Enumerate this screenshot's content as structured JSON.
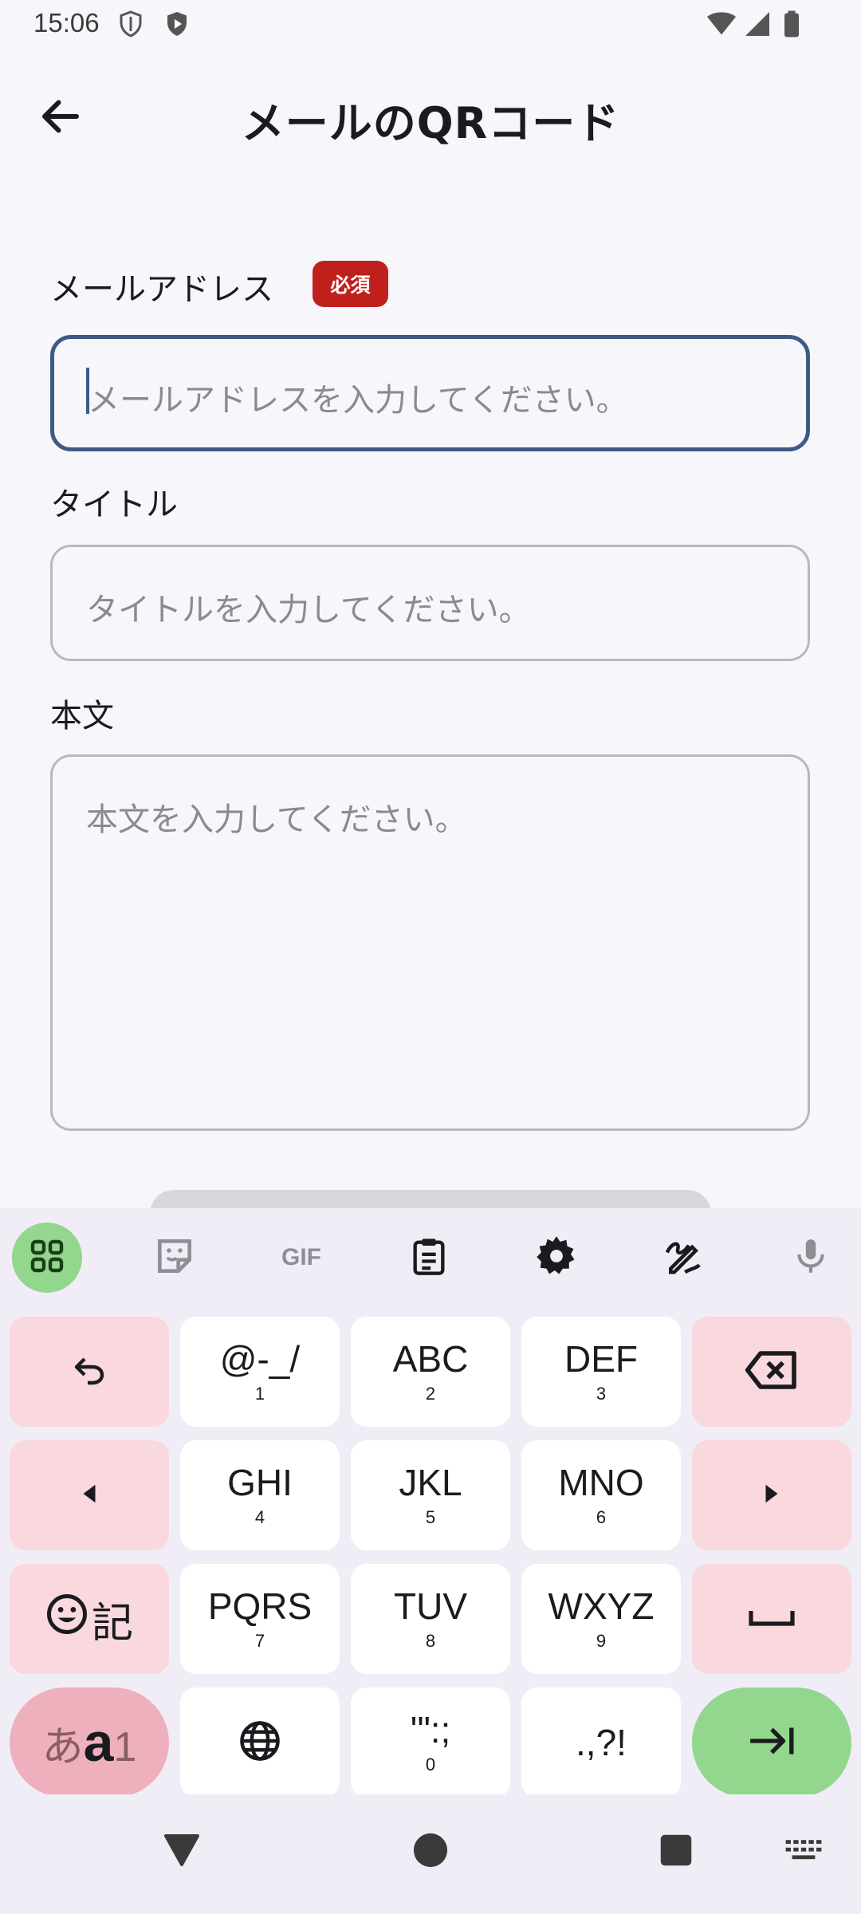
{
  "status_bar": {
    "time": "15:06",
    "icons": [
      "vpn-shield-icon",
      "play-protect-icon",
      "wifi-icon",
      "signal-icon",
      "battery-icon"
    ]
  },
  "app_bar": {
    "title": "メールのQRコード",
    "back_icon": "arrow-left-icon"
  },
  "form": {
    "email": {
      "label": "メールアドレス",
      "required_badge": "必須",
      "placeholder": "メールアドレスを入力してください。",
      "value": ""
    },
    "subject": {
      "label": "タイトル",
      "placeholder": "タイトルを入力してください。",
      "value": ""
    },
    "body": {
      "label": "本文",
      "placeholder": "本文を入力してください。",
      "value": ""
    }
  },
  "keyboard": {
    "toolbar": {
      "gif_label": "GIF",
      "icons": [
        "apps-grid-icon",
        "sticker-icon",
        "gif-icon",
        "clipboard-icon",
        "settings-gear-icon",
        "handwriting-icon",
        "microphone-icon"
      ]
    },
    "keys": {
      "r1c2": {
        "main": "@-_/",
        "sub": "1"
      },
      "r1c3": {
        "main": "ABC",
        "sub": "2"
      },
      "r1c4": {
        "main": "DEF",
        "sub": "3"
      },
      "r2c2": {
        "main": "GHI",
        "sub": "4"
      },
      "r2c3": {
        "main": "JKL",
        "sub": "5"
      },
      "r2c4": {
        "main": "MNO",
        "sub": "6"
      },
      "r3c2": {
        "main": "PQRS",
        "sub": "7"
      },
      "r3c3": {
        "main": "TUV",
        "sub": "8"
      },
      "r3c4": {
        "main": "WXYZ",
        "sub": "9"
      },
      "r4c3": {
        "main": "'\":;",
        "sub": "0"
      },
      "r4c4": {
        "main": ".,?!",
        "sub": ""
      },
      "emoji_kanji": {
        "symbol": "☺",
        "label": "記"
      },
      "mode": {
        "hira": "あ",
        "latin": "a",
        "num": "1"
      }
    }
  },
  "colors": {
    "accent": "#3e5a86",
    "required": "#c0201c",
    "key_function": "#f9d8de",
    "key_enter": "#93d68d",
    "background": "#f7f6fb"
  }
}
